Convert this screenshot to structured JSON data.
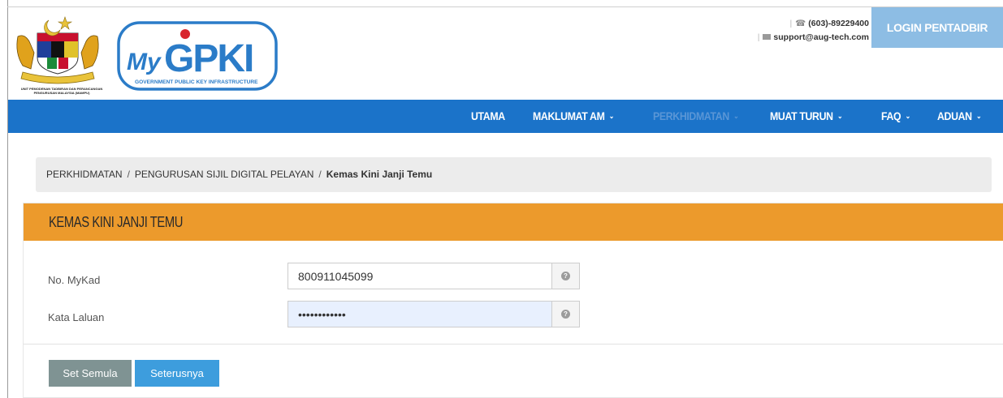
{
  "header": {
    "crest_caption": "UNIT PEMODENAN TADBIRAN DAN PERANCANGAN PENGURUSAN MALAYSIA (MAMPU)",
    "logo_text_my": "My",
    "logo_text_gpki": "GPKI",
    "logo_subtitle": "GOVERNMENT PUBLIC KEY INFRASTRUCTURE",
    "phone": "(603)-89229400",
    "email": "support@aug-tech.com",
    "login_label": "LOGIN PENTADBIR"
  },
  "nav": {
    "items": [
      {
        "label": "UTAMA",
        "dropdown": false
      },
      {
        "label": "MAKLUMAT AM",
        "dropdown": true
      },
      {
        "label": "PERKHIDMATAN",
        "dropdown": true
      },
      {
        "label": "MUAT TURUN",
        "dropdown": true
      },
      {
        "label": "FAQ",
        "dropdown": true
      },
      {
        "label": "ADUAN",
        "dropdown": true
      }
    ],
    "active_color": "#1b73c9"
  },
  "breadcrumb": {
    "items": [
      "PERKHIDMATAN",
      "PENGURUSAN SIJIL DIGITAL PELAYAN"
    ],
    "current": "Kemas Kini Janji Temu"
  },
  "panel": {
    "title": "KEMAS KINI JANJI TEMU",
    "header_color": "#ec9a2c"
  },
  "form": {
    "mykad_label": "No. MyKad",
    "mykad_value": "800911045099",
    "password_label": "Kata Laluan",
    "password_value": "lalu1234abcd",
    "help_icon": "question-circle-icon"
  },
  "buttons": {
    "reset_label": "Set Semula",
    "next_label": "Seterusnya"
  }
}
